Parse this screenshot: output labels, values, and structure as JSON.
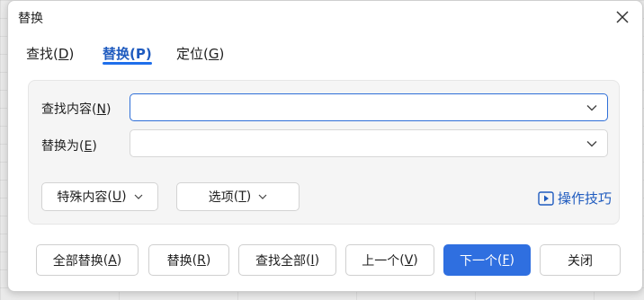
{
  "dialog": {
    "title": "替换",
    "close_icon": "close-icon"
  },
  "tabs": [
    {
      "label": "查找",
      "key": "D",
      "active": false
    },
    {
      "label": "替换",
      "key": "P",
      "active": true
    },
    {
      "label": "定位",
      "key": "G",
      "active": false
    }
  ],
  "find": {
    "label": "查找内容",
    "key": "N",
    "value": "",
    "placeholder": ""
  },
  "replace": {
    "label": "替换为",
    "key": "E",
    "value": "",
    "placeholder": ""
  },
  "options": {
    "special_label": "特殊内容",
    "special_key": "U",
    "options_label": "选项",
    "options_key": "T",
    "tips_label": "操作技巧"
  },
  "footer": {
    "replace_all": {
      "label": "全部替换",
      "key": "A"
    },
    "replace": {
      "label": "替换",
      "key": "R"
    },
    "find_all": {
      "label": "查找全部",
      "key": "I"
    },
    "prev": {
      "label": "上一个",
      "key": "V"
    },
    "next": {
      "label": "下一个",
      "key": "F"
    },
    "close": {
      "label": "关闭"
    }
  },
  "colors": {
    "accent": "#2f6fe0",
    "link": "#1f5bbf"
  }
}
